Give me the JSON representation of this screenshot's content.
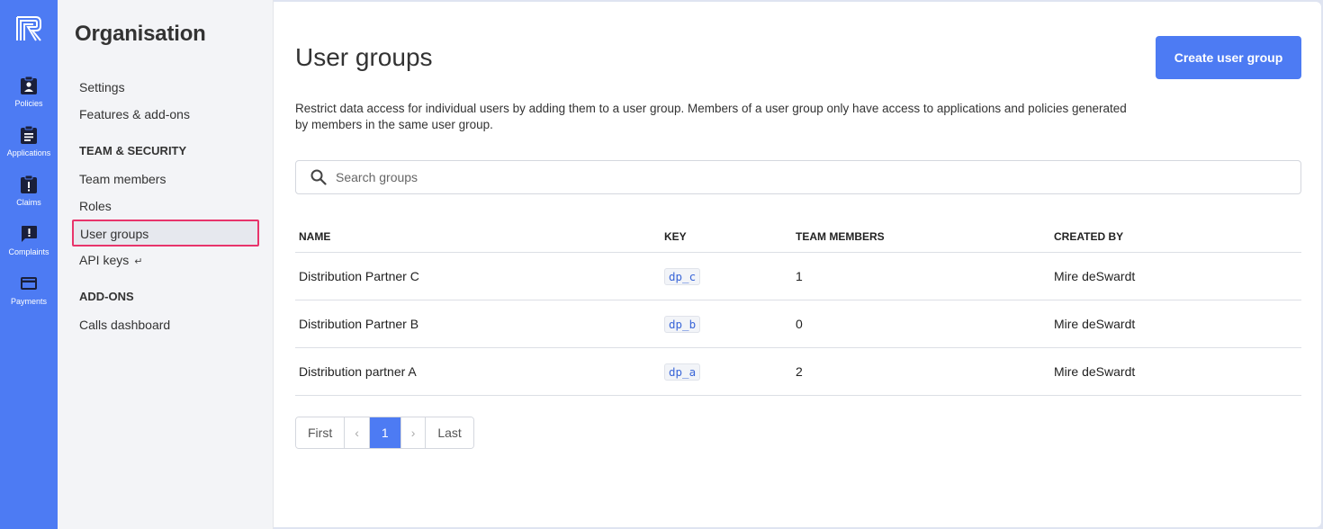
{
  "colors": {
    "accent": "#4d7bf3",
    "highlight": "#e8346b"
  },
  "rail": {
    "logo_icon": "brand-logo-icon",
    "items": [
      {
        "label": "Policies",
        "icon": "clipboard-person-icon"
      },
      {
        "label": "Applications",
        "icon": "clipboard-list-icon"
      },
      {
        "label": "Claims",
        "icon": "clipboard-alert-icon"
      },
      {
        "label": "Complaints",
        "icon": "message-alert-icon"
      },
      {
        "label": "Payments",
        "icon": "credit-card-icon"
      }
    ]
  },
  "sidebar": {
    "title": "Organisation",
    "items": [
      {
        "label": "Settings"
      },
      {
        "label": "Features & add-ons"
      }
    ],
    "team_section": "TEAM & SECURITY",
    "team_items": [
      {
        "label": "Team members"
      },
      {
        "label": "Roles"
      },
      {
        "label": "User groups"
      },
      {
        "label": "API keys",
        "suffix": "↵"
      }
    ],
    "addons_section": "ADD-ONS",
    "addons_items": [
      {
        "label": "Calls dashboard"
      }
    ]
  },
  "main": {
    "title": "User groups",
    "create_button": "Create user group",
    "description": "Restrict data access for individual users by adding them to a user group. Members of a user group only have access to applications and policies generated by members in the same user group.",
    "search_placeholder": "Search groups",
    "columns": [
      "NAME",
      "KEY",
      "TEAM MEMBERS",
      "CREATED BY"
    ],
    "rows": [
      {
        "name": "Distribution Partner C",
        "key": "dp_c",
        "members": "1",
        "created_by": "Mire deSwardt"
      },
      {
        "name": "Distribution Partner B",
        "key": "dp_b",
        "members": "0",
        "created_by": "Mire deSwardt"
      },
      {
        "name": "Distribution partner A",
        "key": "dp_a",
        "members": "2",
        "created_by": "Mire deSwardt"
      }
    ],
    "pagination": {
      "first": "First",
      "prev": "‹",
      "current": "1",
      "next": "›",
      "last": "Last"
    }
  }
}
